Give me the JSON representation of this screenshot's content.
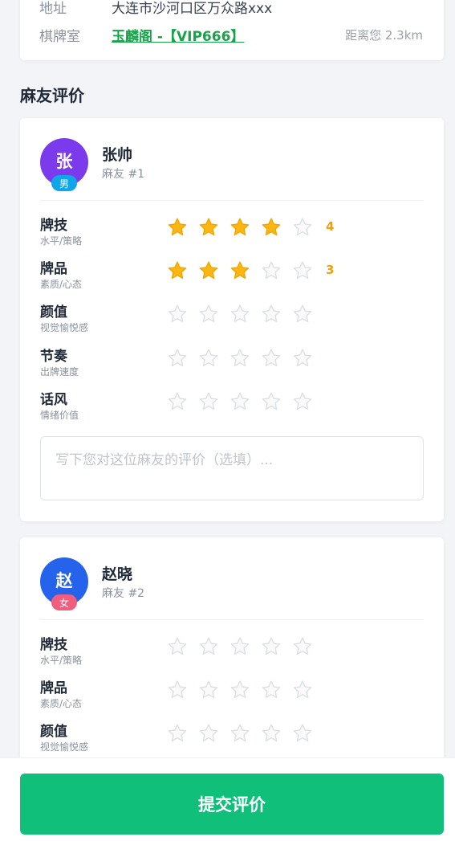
{
  "info": {
    "address_label": "地址",
    "address_value": "大连市沙河口区万众路xxx",
    "room_label": "棋牌室",
    "room_link": "玉麟阁 -【VIP666】",
    "distance": "距离您 2.3km"
  },
  "section_title": "麻友评价",
  "players": [
    {
      "avatar_char": "张",
      "gender": "男",
      "name": "张帅",
      "number": "麻友 #1",
      "criteria": [
        {
          "name": "牌技",
          "sub": "水平/策略",
          "rating": 4,
          "score_text": "4"
        },
        {
          "name": "牌品",
          "sub": "素质/心态",
          "rating": 3,
          "score_text": "3"
        },
        {
          "name": "颜值",
          "sub": "视觉愉悦感",
          "rating": 0,
          "score_text": ""
        },
        {
          "name": "节奏",
          "sub": "出牌速度",
          "rating": 0,
          "score_text": ""
        },
        {
          "name": "话风",
          "sub": "情绪价值",
          "rating": 0,
          "score_text": ""
        }
      ],
      "comment_placeholder": "写下您对这位麻友的评价（选填）..."
    },
    {
      "avatar_char": "赵",
      "gender": "女",
      "name": "赵晓",
      "number": "麻友 #2",
      "criteria": [
        {
          "name": "牌技",
          "sub": "水平/策略",
          "rating": 0,
          "score_text": ""
        },
        {
          "name": "牌品",
          "sub": "素质/心态",
          "rating": 0,
          "score_text": ""
        },
        {
          "name": "颜值",
          "sub": "视觉愉悦感",
          "rating": 0,
          "score_text": ""
        }
      ]
    }
  ],
  "submit_label": "提交评价",
  "colors": {
    "accent": "#0fbf7a",
    "star_on": "#fbb614",
    "score": "#f59e0b",
    "link": "#16a34a"
  },
  "icons": {
    "star": "star-icon"
  }
}
